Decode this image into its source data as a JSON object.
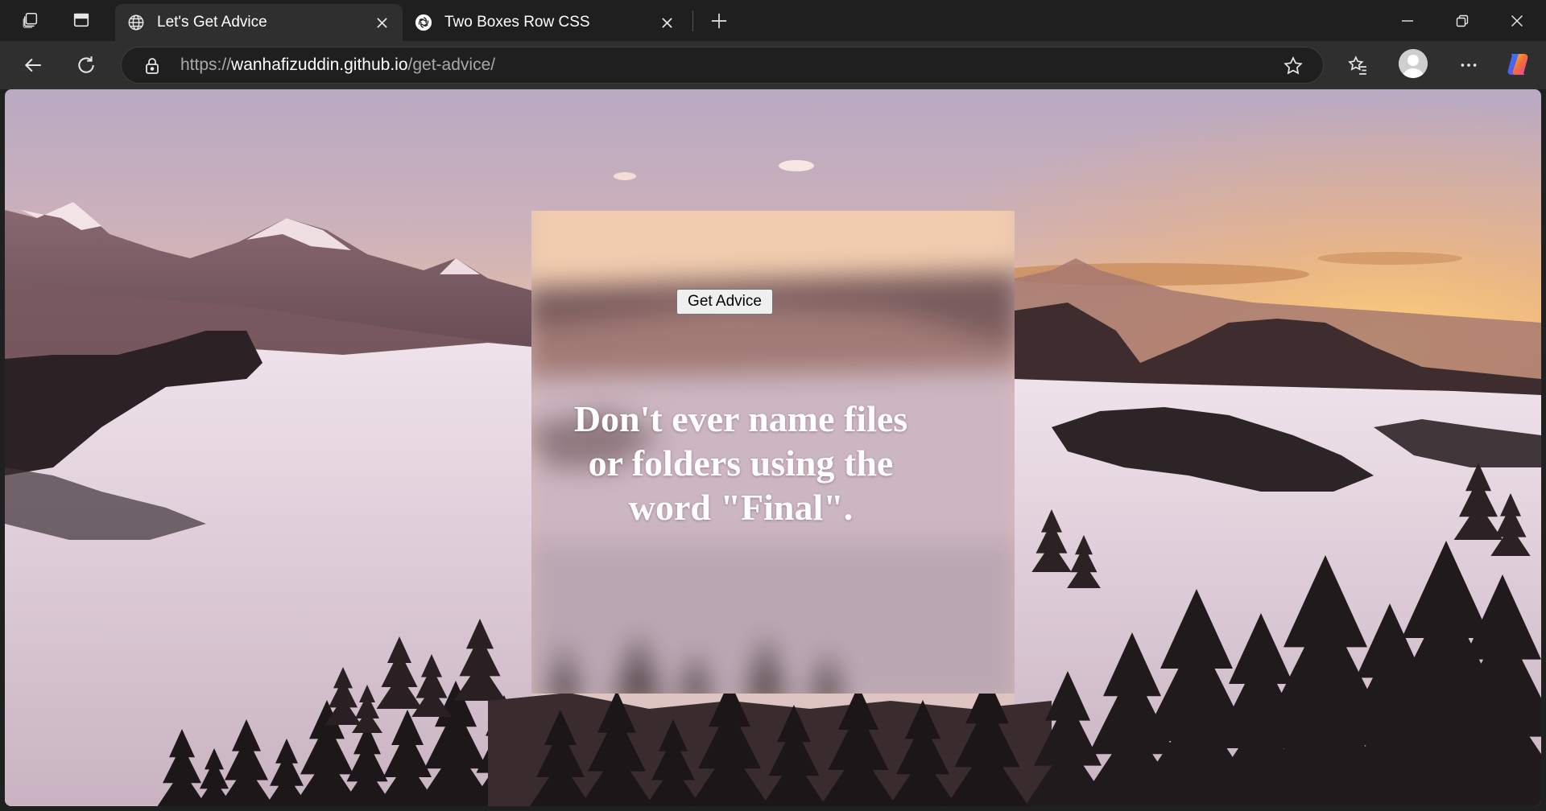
{
  "browser": {
    "tabs": [
      {
        "title": "Let's Get Advice",
        "active": true,
        "favicon": "globe-icon"
      },
      {
        "title": "Two Boxes Row CSS",
        "active": false,
        "favicon": "openai-icon"
      }
    ],
    "address_bar": {
      "scheme": "https://",
      "host": "wanhafizuddin.github.io",
      "path": "/get-advice/"
    },
    "accent_colors": {
      "chrome": "#1f1f1f",
      "toolbar": "#2f2f2f",
      "address": "#1f1f1f"
    }
  },
  "page": {
    "button_label": "Get Advice",
    "advice": "Don't ever name files or folders using the word \"Final\"."
  }
}
